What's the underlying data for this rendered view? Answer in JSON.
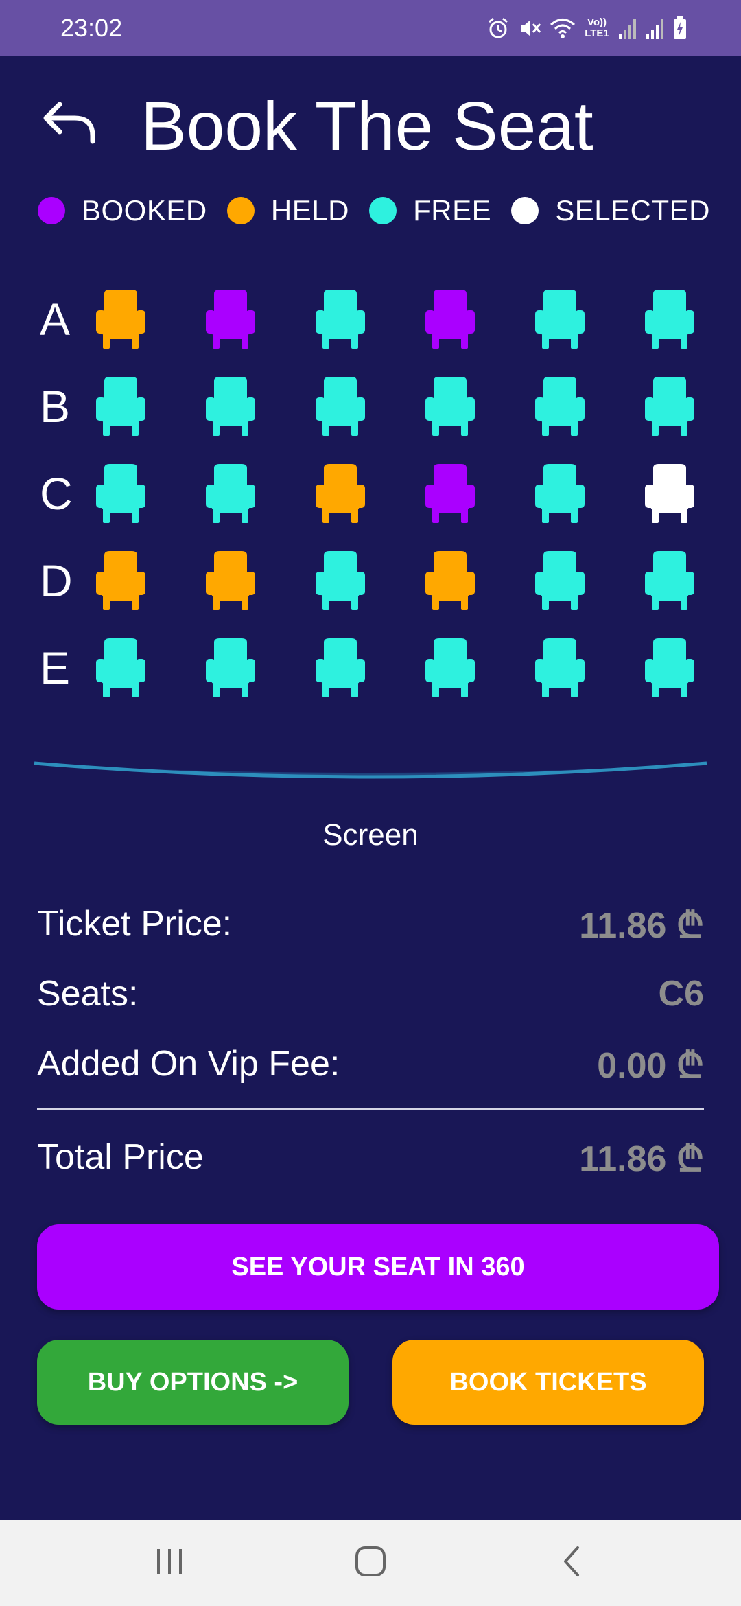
{
  "status_bar": {
    "time": "23:02",
    "network_label": "Vo)) LTE1",
    "icons": [
      "alarm-icon",
      "mute-icon",
      "wifi-icon",
      "lte-icon",
      "signal-icon",
      "signal-icon",
      "battery-charging-icon"
    ]
  },
  "header": {
    "title": "Book The Seat",
    "back_icon": "back-arrow-icon"
  },
  "colors": {
    "background": "#191756",
    "status_bar": "#6750a4",
    "booked": "#aa00ff",
    "held": "#ffa800",
    "free": "#2ef1df",
    "selected": "#ffffff",
    "buy_options": "#33a83a",
    "price_value": "#8d8d8d"
  },
  "legend": [
    {
      "label": "BOOKED",
      "status": "booked"
    },
    {
      "label": "HELD",
      "status": "held"
    },
    {
      "label": "FREE",
      "status": "free"
    },
    {
      "label": "SELECTED",
      "status": "selected"
    }
  ],
  "seat_rows": [
    {
      "label": "A",
      "seats": [
        "held",
        "booked",
        "free",
        "booked",
        "free",
        "free"
      ]
    },
    {
      "label": "B",
      "seats": [
        "free",
        "free",
        "free",
        "free",
        "free",
        "free"
      ]
    },
    {
      "label": "C",
      "seats": [
        "free",
        "free",
        "held",
        "booked",
        "free",
        "selected"
      ]
    },
    {
      "label": "D",
      "seats": [
        "held",
        "held",
        "free",
        "held",
        "free",
        "free"
      ]
    },
    {
      "label": "E",
      "seats": [
        "free",
        "free",
        "free",
        "free",
        "free",
        "free"
      ]
    }
  ],
  "screen_label": "Screen",
  "summary": {
    "ticket_price_label": "Ticket Price:",
    "ticket_price_value": "11.86 ₾",
    "seats_label": "Seats:",
    "seats_value": "C6",
    "vip_fee_label": "Added On Vip Fee:",
    "vip_fee_value": "0.00 ₾",
    "total_label": "Total Price",
    "total_value": "11.86 ₾"
  },
  "buttons": {
    "see_360": "SEE YOUR SEAT IN 360",
    "buy_options": "BUY OPTIONS ->",
    "book_tickets": "BOOK TICKETS"
  },
  "nav_bar": {
    "icons": [
      "recent-apps-icon",
      "home-icon",
      "back-icon"
    ]
  }
}
